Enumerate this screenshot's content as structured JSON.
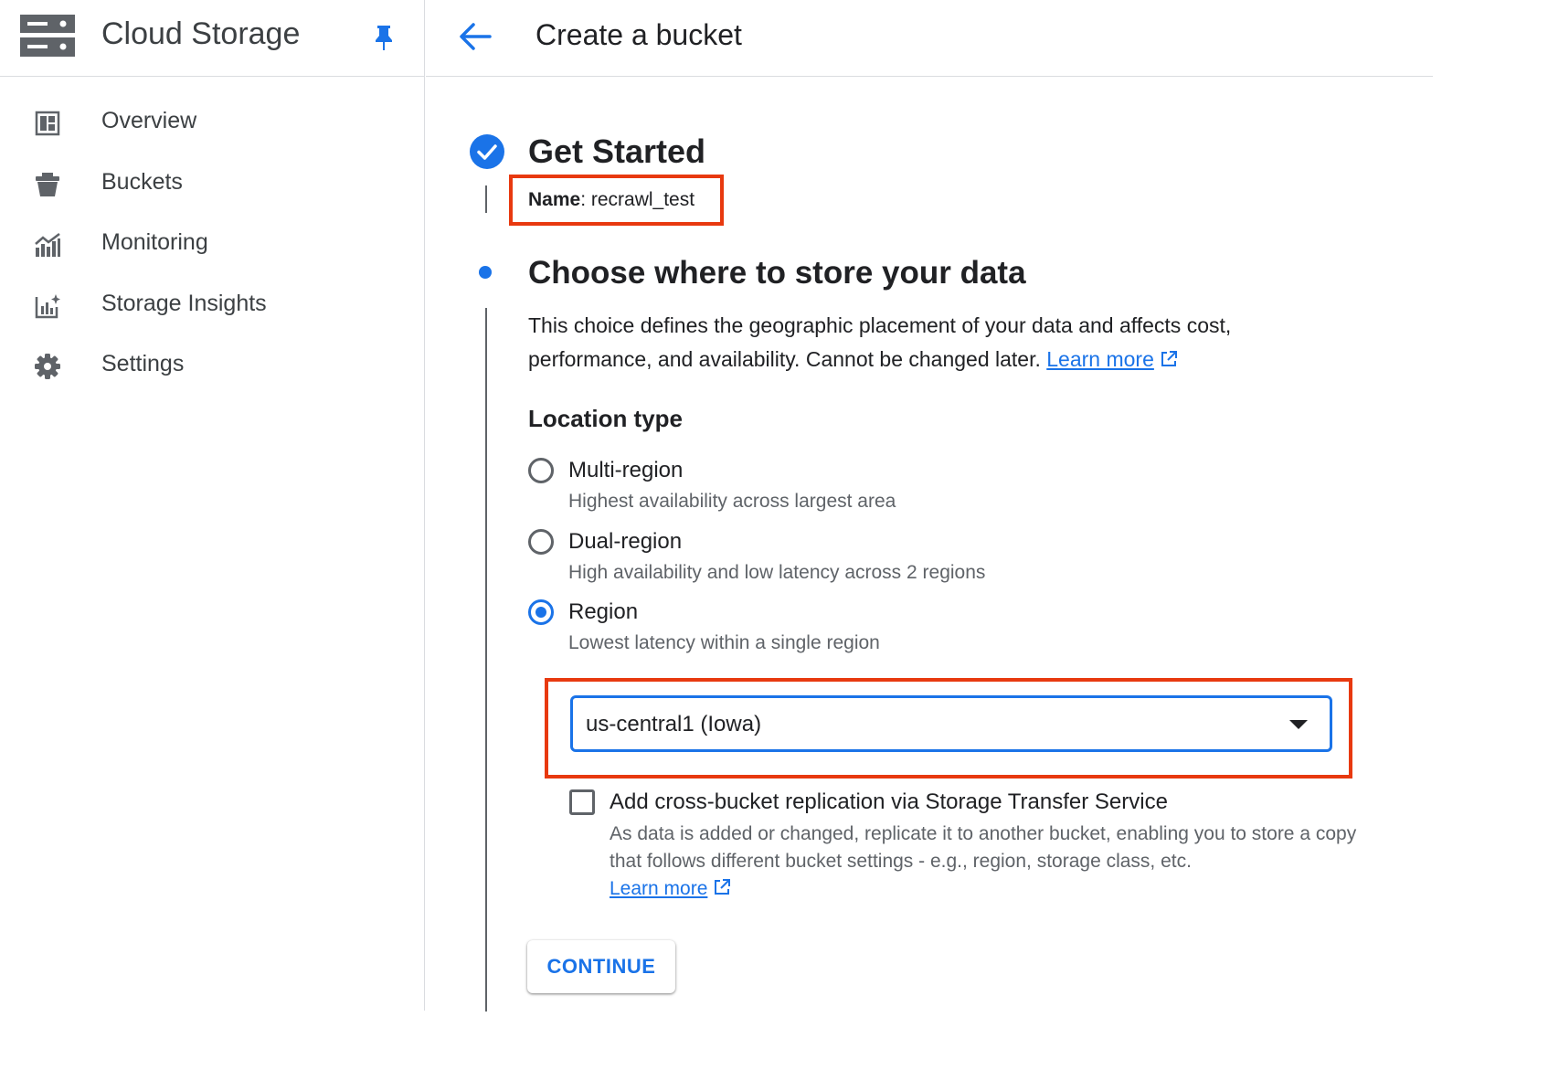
{
  "sidebar": {
    "product_title": "Cloud Storage",
    "items": [
      {
        "label": "Overview",
        "icon": "dashboard-icon"
      },
      {
        "label": "Buckets",
        "icon": "bucket-icon"
      },
      {
        "label": "Monitoring",
        "icon": "monitoring-icon"
      },
      {
        "label": "Storage Insights",
        "icon": "insights-icon"
      },
      {
        "label": "Settings",
        "icon": "gear-icon"
      }
    ]
  },
  "header": {
    "title": "Create a bucket"
  },
  "step1": {
    "title": "Get Started",
    "name_label": "Name",
    "name_value": ": recrawl_test"
  },
  "step2": {
    "title": "Choose where to store your data",
    "description": "This choice defines the geographic placement of your data and affects cost, performance, and availability. Cannot be changed later.",
    "learn_more": "Learn more",
    "location_type_label": "Location type",
    "options": [
      {
        "label": "Multi-region",
        "description": "Highest availability across largest area",
        "selected": false
      },
      {
        "label": "Dual-region",
        "description": "High availability and low latency across 2 regions",
        "selected": false
      },
      {
        "label": "Region",
        "description": "Lowest latency within a single region",
        "selected": true
      }
    ],
    "region_select_value": "us-central1 (Iowa)",
    "replication": {
      "label": "Add cross-bucket replication via Storage Transfer Service",
      "description": "As data is added or changed, replicate it to another bucket, enabling you to store a copy that follows different bucket settings - e.g., region, storage class, etc.",
      "learn_more": "Learn more",
      "checked": false
    },
    "continue_label": "CONTINUE"
  },
  "colors": {
    "accent": "#1a73e8",
    "highlight": "#e8390f",
    "text_secondary": "#5f6368"
  }
}
